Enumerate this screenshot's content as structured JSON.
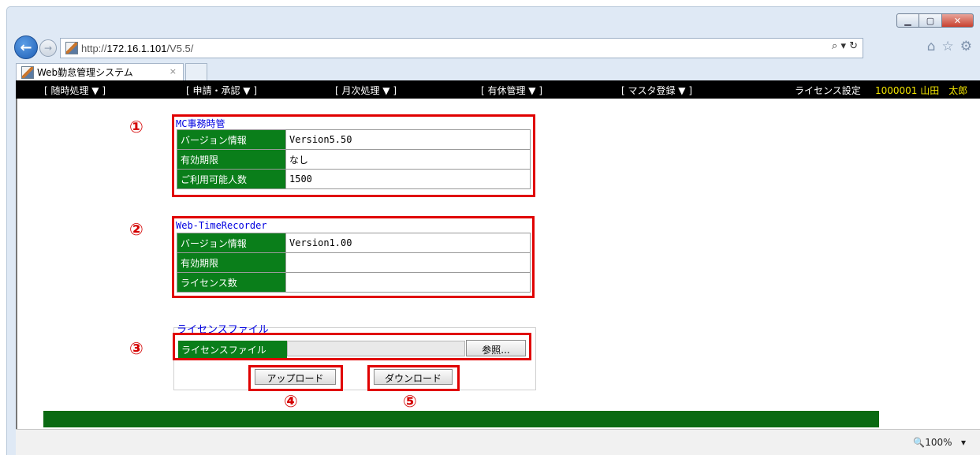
{
  "browser": {
    "url_prefix": "http://",
    "url_host": "172.16.1.101",
    "url_path": "/V5.5/",
    "tab_title": "Web勤怠管理システム",
    "tab_close": "×",
    "zoom": "🔍100%",
    "zoom_dropdown": "▾",
    "window_buttons": [
      "minimize-icon",
      "maximize-icon",
      "close-icon"
    ]
  },
  "menu": {
    "items": [
      "[ 随時処理 ▼ ]",
      "[ 申請・承認 ▼ ]",
      "[ 月次処理 ▼ ]",
      "[ 有休管理 ▼ ]",
      "[ マスタ登録 ▼ ]"
    ],
    "license": "ライセンス設定",
    "user": "1000001 山田　太郎"
  },
  "panels": {
    "mc": {
      "marker": "①",
      "title": "MC事務時管",
      "rows": [
        {
          "label": "バージョン情報",
          "value": "Version5.50"
        },
        {
          "label": "有効期限",
          "value": "なし"
        },
        {
          "label": "ご利用可能人数",
          "value": "1500"
        }
      ]
    },
    "wtr": {
      "marker": "②",
      "title": "Web-TimeRecorder",
      "rows": [
        {
          "label": "バージョン情報",
          "value": "Version1.00"
        },
        {
          "label": "有効期限",
          "value": ""
        },
        {
          "label": "ライセンス数",
          "value": ""
        }
      ]
    },
    "license_file": {
      "marker": "③",
      "title": "ライセンスファイル",
      "label": "ライセンスファイル",
      "browse": "参照..."
    }
  },
  "actions": {
    "upload": {
      "marker": "④",
      "label": "アップロード"
    },
    "download": {
      "marker": "⑤",
      "label": "ダウンロード"
    }
  },
  "colors": {
    "accent_green": "#0a7e1a",
    "highlight_red": "#e00000",
    "title_blue": "#0000e0"
  }
}
